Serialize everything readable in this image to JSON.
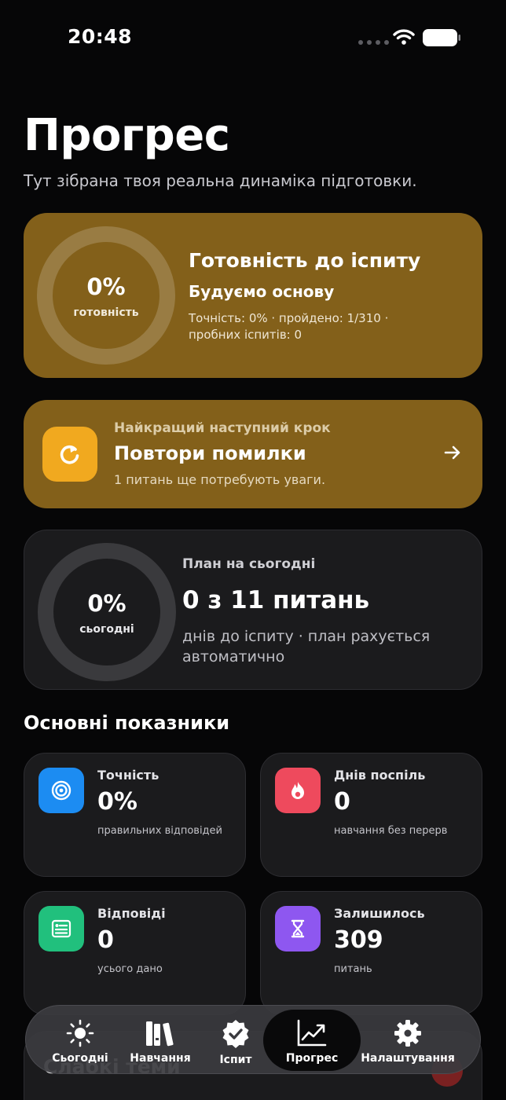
{
  "status_bar": {
    "time": "20:48"
  },
  "header": {
    "title": "Прогрес",
    "subtitle": "Тут зібрана твоя реальна динаміка підготовки."
  },
  "readiness": {
    "percent": "0%",
    "percent_caption": "готовність",
    "title": "Готовність до іспиту",
    "level": "Будуємо основу",
    "stats": "Точність: 0% · пройдено: 1/310 · пробних іспитів: 0"
  },
  "next_step": {
    "kicker": "Найкращий наступний крок",
    "title": "Повтори помилки",
    "description": "1 питань ще потребують уваги.",
    "icon": "refresh-icon"
  },
  "plan": {
    "percent": "0%",
    "percent_caption": "сьогодні",
    "kicker": "План на сьогодні",
    "title": "0 з 11 питань",
    "description": "днів до іспиту · план рахується автоматично"
  },
  "metrics": {
    "section_title": "Основні показники",
    "items": [
      {
        "label": "Точність",
        "value": "0%",
        "description": "правильних відповідей",
        "icon": "target-icon",
        "color": "#1c8cf2"
      },
      {
        "label": "Днів поспіль",
        "value": "0",
        "description": "навчання без перерв",
        "icon": "flame-icon",
        "color": "#ee4a5d"
      },
      {
        "label": "Відповіді",
        "value": "0",
        "description": "усього дано",
        "icon": "answers-icon",
        "color": "#21c07d"
      },
      {
        "label": "Залишилось",
        "value": "309",
        "description": "питань",
        "icon": "hourglass-icon",
        "color": "#8e57f0"
      }
    ]
  },
  "weak_topics": {
    "title": "Слабкі теми"
  },
  "tab_bar": {
    "tabs": [
      {
        "label": "Сьогодні",
        "icon": "sun-icon"
      },
      {
        "label": "Навчання",
        "icon": "books-icon"
      },
      {
        "label": "Іспит",
        "icon": "check-badge-icon"
      },
      {
        "label": "Прогрес",
        "icon": "chart-icon",
        "active": true
      },
      {
        "label": "Налаштування",
        "icon": "gear-icon"
      }
    ]
  },
  "colors": {
    "accent_card": "#83601a",
    "next_icon_bg": "#f1a91f",
    "card_bg": "#1b1b1d",
    "background": "#060607"
  }
}
